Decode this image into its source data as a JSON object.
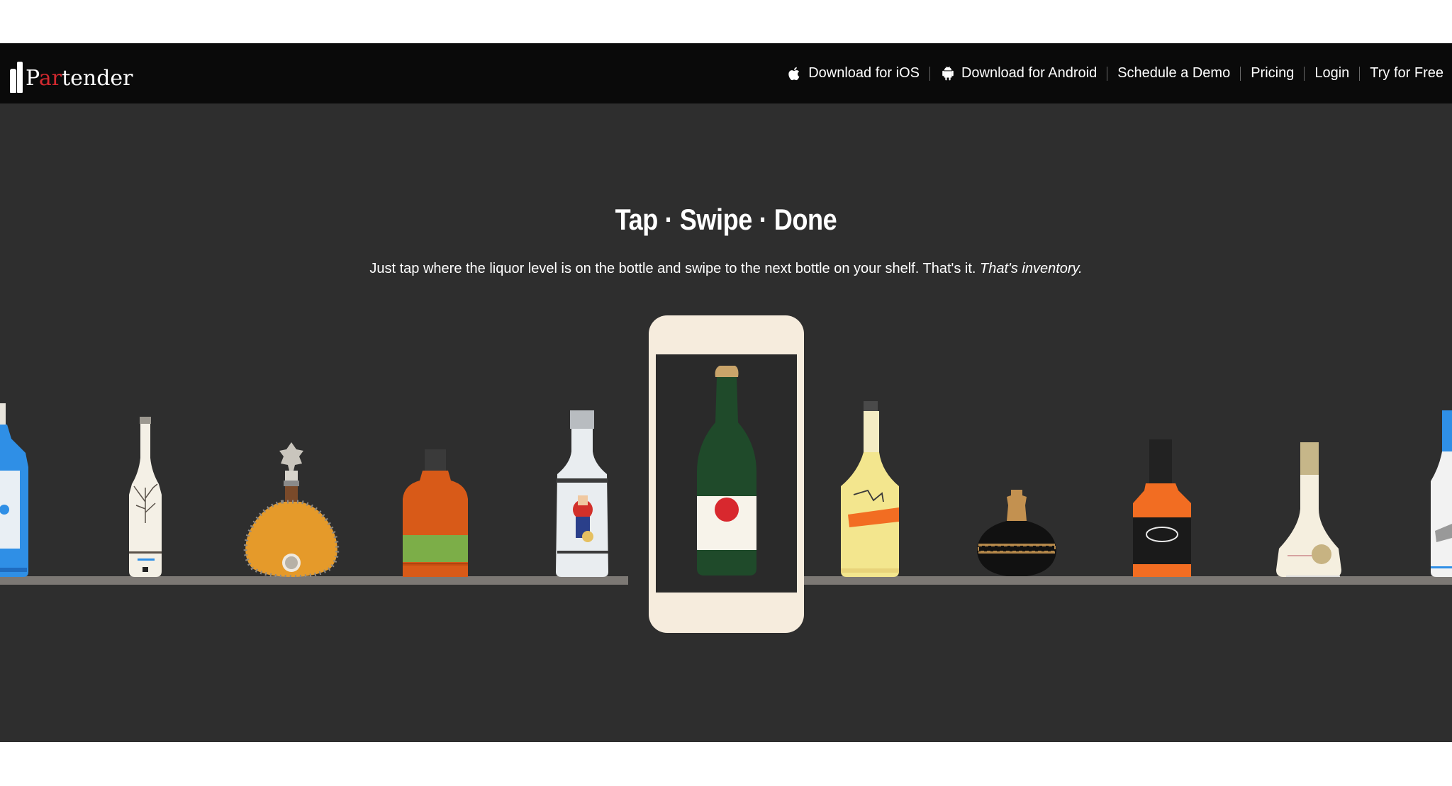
{
  "nav": {
    "logo_text_prefix": "P",
    "logo_text_red": "ar",
    "logo_text_suffix": "tender",
    "links": [
      {
        "label": "Download for iOS",
        "icon": "apple-icon"
      },
      {
        "label": "Download for Android",
        "icon": "android-icon"
      },
      {
        "label": "Schedule a Demo"
      },
      {
        "label": "Pricing"
      },
      {
        "label": "Login"
      },
      {
        "label": "Try for Free"
      }
    ]
  },
  "hero": {
    "headline": "Tap · Swipe · Done",
    "subline_main": "Just tap where the liquor level is on the bottle and swipe to the next bottle on your shelf. That's it. ",
    "subline_emphasis": "That's inventory."
  },
  "colors": {
    "background": "#2e2e2e",
    "navbar": "#0a0a0a",
    "shelf": "#7c7874",
    "phone": "#f6ecdd",
    "logo_accent": "#d3292f"
  },
  "illustration": {
    "bottles": [
      "blue-gin-bottle-icon",
      "white-tree-bottle-icon",
      "cognac-decanter-icon",
      "orange-bourbon-bottle-icon",
      "white-rum-bottle-icon",
      "green-sake-bottle-icon",
      "yellow-whisky-bottle-icon",
      "black-round-bottle-icon",
      "whiskey-square-bottle-icon",
      "cream-liqueur-bottle-icon",
      "blue-white-bottle-icon"
    ]
  }
}
